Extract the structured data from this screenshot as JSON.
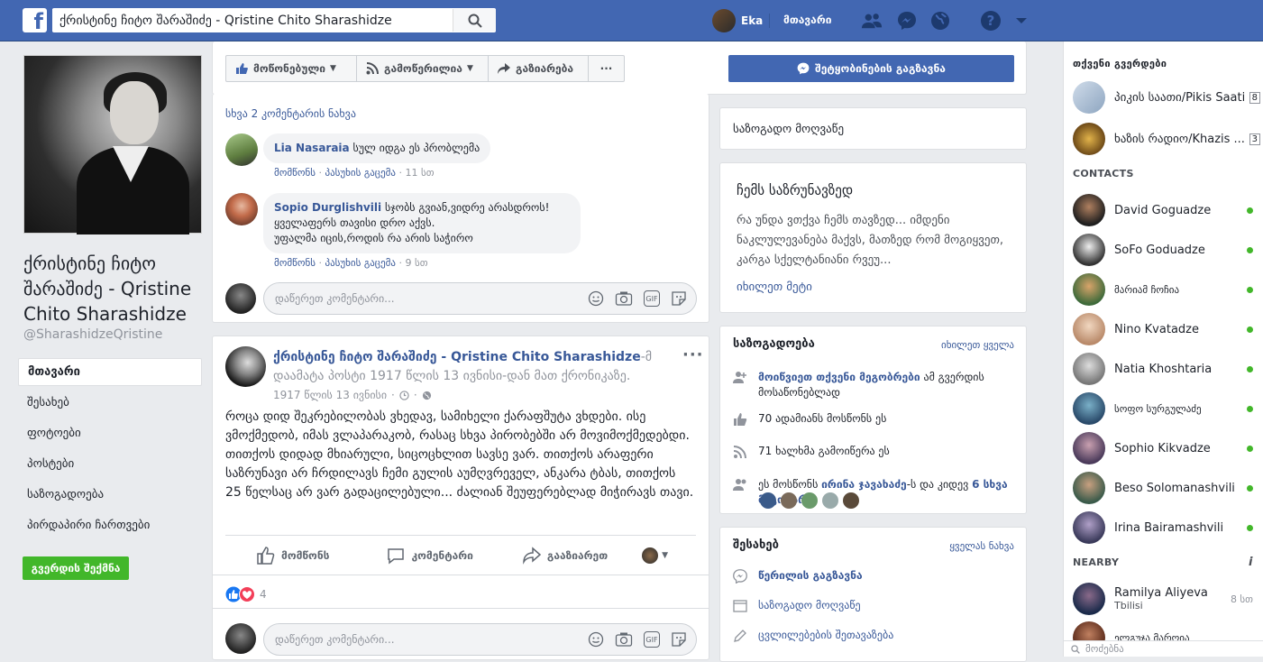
{
  "topbar": {
    "logo": "f",
    "search_value": "ქრისტინე ჩიტო შარაშიძე - Qristine Chito Sharashidze",
    "user_name": "Eka",
    "home_label": "მთავარი"
  },
  "page": {
    "name": "ქრისტინე ჩიტო შარაშიძე - Qristine Chito Sharashidze",
    "handle": "@SharashidzeQristine",
    "nav": [
      "მთავარი",
      "შესახებ",
      "ფოტოები",
      "პოსტები",
      "საზოგადოება",
      "პირდაპირი ჩართვები"
    ],
    "create_page_label": "გვერდის შექმნა"
  },
  "action_bar": {
    "liked_label": "მოწონებული",
    "following_label": "გამოწერილია",
    "share_label": "გაზიარება",
    "more_label": "···",
    "send_message_label": "შეტყობინების გაგზავნა"
  },
  "comments_card": {
    "view_more": "სხვა 2 კომენტარის ნახვა",
    "comments": [
      {
        "author": "Lia Nasaraia",
        "text": "სულ იდგა ეს პრობლემა",
        "like": "მომწონს",
        "reply": "პასუხის გაცემა",
        "time": "11 სთ"
      },
      {
        "author": "Sopio Durglishvili",
        "line1": "სჯობს გვიან,ვიდრე არასდროს!",
        "line2": "ყველაფერს თავისი დრო აქვს.",
        "line3": "უფალმა იცის,როდის რა არის საჭირო",
        "like": "მომწონს",
        "reply": "პასუხის გაცემა",
        "time": "9 სთ"
      }
    ],
    "input_placeholder": "დაწერეთ კომენტარი..."
  },
  "post": {
    "author": "ქრისტინე ჩიტო შარაშიძე - Qristine Chito Sharashidze",
    "author_suffix": "-მ",
    "action_text": "დაამატა პოსტი 1917 წლის 13 ივნისი-დან მათ ქრონიკაზე.",
    "date": "1917 წლის 13 ივნისი",
    "body": "როცა დიდ შეკრებილობას ვხედავ, სამიხელი ქარაფშუტა ვხდები. ისე ვმოქმედობ, იმას ვლაპარაკობ, რასაც სხვა პირობებში არ მოვიმოქმედებდი. თითქოს დიდად მხიარული, სიცოცხლით სავსე ვარ. თითქოს არაფერი საზრუნავი არ ჩრდილავს ჩემი გულის აუმღვრეველ, ანკარა ტბას, თითქოს 25 წელსაც არ ვარ გადაცილებული... ძალიან შეუფერებლად მიჭირავს თავი.",
    "like_label": "მომწონს",
    "comment_label": "კომენტარი",
    "share_label": "გააზიარეთ",
    "reaction_count": "4",
    "input_placeholder": "დაწერეთ კომენტარი..."
  },
  "right": {
    "category": "საზოგადო მოღვაწე",
    "story_title": "ჩემს საზრუნავზედ",
    "story_text": "რა უნდა ვთქვა ჩემს თავზედ... იმდენი ნაკლულევანება მაქვს, მათზედ რომ მოგიყვეთ, კარგა სქელტანიანი რვეუ...",
    "story_more": "იხილეთ მეტი",
    "community_title": "საზოგადოება",
    "community_all": "იხილეთ ყველა",
    "invite_link": "მოიწვიეთ თქვენი მეგობრები",
    "invite_rest": "ამ გვერდის მოსაწონებლად",
    "likes_text": "70 ადამიანს მოსწონს ეს",
    "follows_text": "71 ხალხმა გამოიწერა ეს",
    "friends_pre": "ეს მოსწონს",
    "friends_name": "ირინა ჯავახაძე",
    "friends_mid": "-ს და კიდევ",
    "friends_more": "6 სხვა მეგობარს",
    "about_title": "შესახებ",
    "about_all": "ყველას ნახვა",
    "send_message": "წერილის გაგზავნა",
    "public_figure": "საზოგადო მოღვაწე",
    "suggest_edits": "ცვლილებების შეთავაზება"
  },
  "chat": {
    "pages_title": "თქვენი გვერდები",
    "pages": [
      {
        "name": "პიკის საათი/Pikis Saati",
        "count": "8"
      },
      {
        "name": "ხაზის რადიო/Khazis ...",
        "count": "3"
      }
    ],
    "contacts_title": "CONTACTS",
    "contacts": [
      "David Goguadze",
      "SoFo Goduadze",
      "მარიამ ჩოჩია",
      "Nino Kvatadze",
      "Natia Khoshtaria",
      "სოფო სურგულაძე",
      "Sophio Kikvadze",
      "Beso Solomanashvili",
      "Irina Bairamashvili"
    ],
    "nearby_title": "NEARBY",
    "nearby": [
      {
        "name": "Ramilya Aliyeva",
        "sub": "Tbilisi",
        "time": "8 სთ"
      },
      {
        "name": "ელგუჯა მარღია",
        "sub": "",
        "time": ""
      }
    ],
    "search_placeholder": "მოძებნა"
  },
  "colors": {
    "brand": "#4267b2",
    "link": "#385898",
    "online": "#42b72a",
    "create": "#42b72a"
  }
}
